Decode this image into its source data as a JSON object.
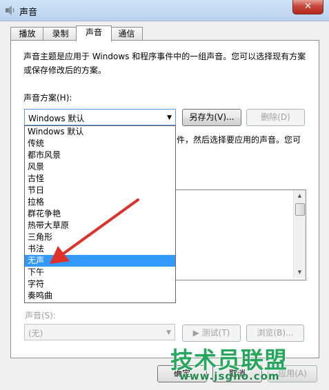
{
  "window": {
    "title": "声音",
    "close_symbol": "✕"
  },
  "tabs": [
    {
      "label": "播放",
      "active": false
    },
    {
      "label": "录制",
      "active": false
    },
    {
      "label": "声音",
      "active": true
    },
    {
      "label": "通信",
      "active": false
    }
  ],
  "sounds_tab": {
    "description": "声音主题是应用于 Windows 和程序事件中的一组声音。您可以选择现有方案或保存修改后的方案。",
    "scheme_label": "声音方案(H):",
    "scheme_value": "Windows 默认",
    "save_as_label": "另存为(V)...",
    "delete_label": "删除(D)",
    "partial_text": "件，然后选择要应用的声音。您可",
    "sound_label": "声音(S):",
    "sound_value": "(无)",
    "test_label": "▶ 测试(T)",
    "browse_label": "浏览(B)..."
  },
  "dropdown": {
    "items": [
      "Windows 默认",
      "传统",
      "都市风景",
      "风景",
      "古怪",
      "节日",
      "拉格",
      "群花争艳",
      "热带大草原",
      "三角形",
      "书法",
      "无声",
      "下午",
      "字符",
      "奏鸣曲"
    ],
    "selected": "无声"
  },
  "footer": {
    "ok_label": "确定",
    "cancel_label": "取消",
    "apply_label": "应用(A)"
  },
  "watermark": {
    "text": "技术员联盟",
    "url": "www.jsgho.com"
  },
  "colors": {
    "selection": "#3399ff",
    "watermark": "#25a85c",
    "arrow": "#e0302a"
  }
}
